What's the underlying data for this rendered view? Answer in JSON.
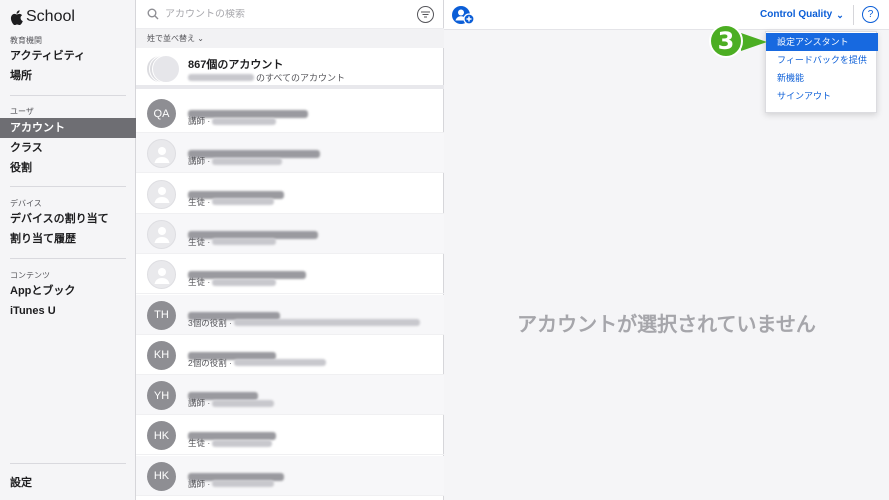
{
  "sidebar": {
    "brand": "School",
    "sections": {
      "education": "教育機関",
      "users": "ユーザ",
      "devices": "デバイス",
      "content": "コンテンツ"
    },
    "items": {
      "activity": "アクティビティ",
      "locations": "場所",
      "accounts": "アカウント",
      "classes": "クラス",
      "roles": "役割",
      "device_assignments": "デバイスの割り当て",
      "assignment_history": "割り当て履歴",
      "apps_books": "Appとブック",
      "itunes_u": "iTunes U",
      "settings": "設定"
    }
  },
  "list": {
    "search_placeholder": "アカウントの検索",
    "sort_label": "姓で並べ替え",
    "summary_title": "867個のアカウント",
    "summary_sub": "のすべてのアカウント",
    "rows": [
      {
        "initials": "QA",
        "sub": "講師 ·"
      },
      {
        "initials": "",
        "sub": "講師 ·"
      },
      {
        "initials": "",
        "sub": "生徒 ·"
      },
      {
        "initials": "",
        "sub": "生徒 ·"
      },
      {
        "initials": "",
        "sub": "生徒 ·"
      },
      {
        "initials": "TH",
        "sub": "3個の役割 ·"
      },
      {
        "initials": "KH",
        "sub": "2個の役割 ·"
      },
      {
        "initials": "YH",
        "sub": "講師 ·"
      },
      {
        "initials": "HK",
        "sub": "生徒 ·"
      },
      {
        "initials": "HK",
        "sub": "講師 ·"
      }
    ]
  },
  "header": {
    "org_name": "Control Quality",
    "help": "?"
  },
  "detail": {
    "empty_message": "アカウントが選択されていません"
  },
  "menu": {
    "items": [
      "設定アシスタント",
      "フィードバックを提供",
      "新機能",
      "サインアウト"
    ]
  },
  "annotation": {
    "step": "3"
  },
  "colors": {
    "accent": "#0b5ed7",
    "active_nav": "#6e6e73",
    "badge_green": "#4cae23"
  }
}
